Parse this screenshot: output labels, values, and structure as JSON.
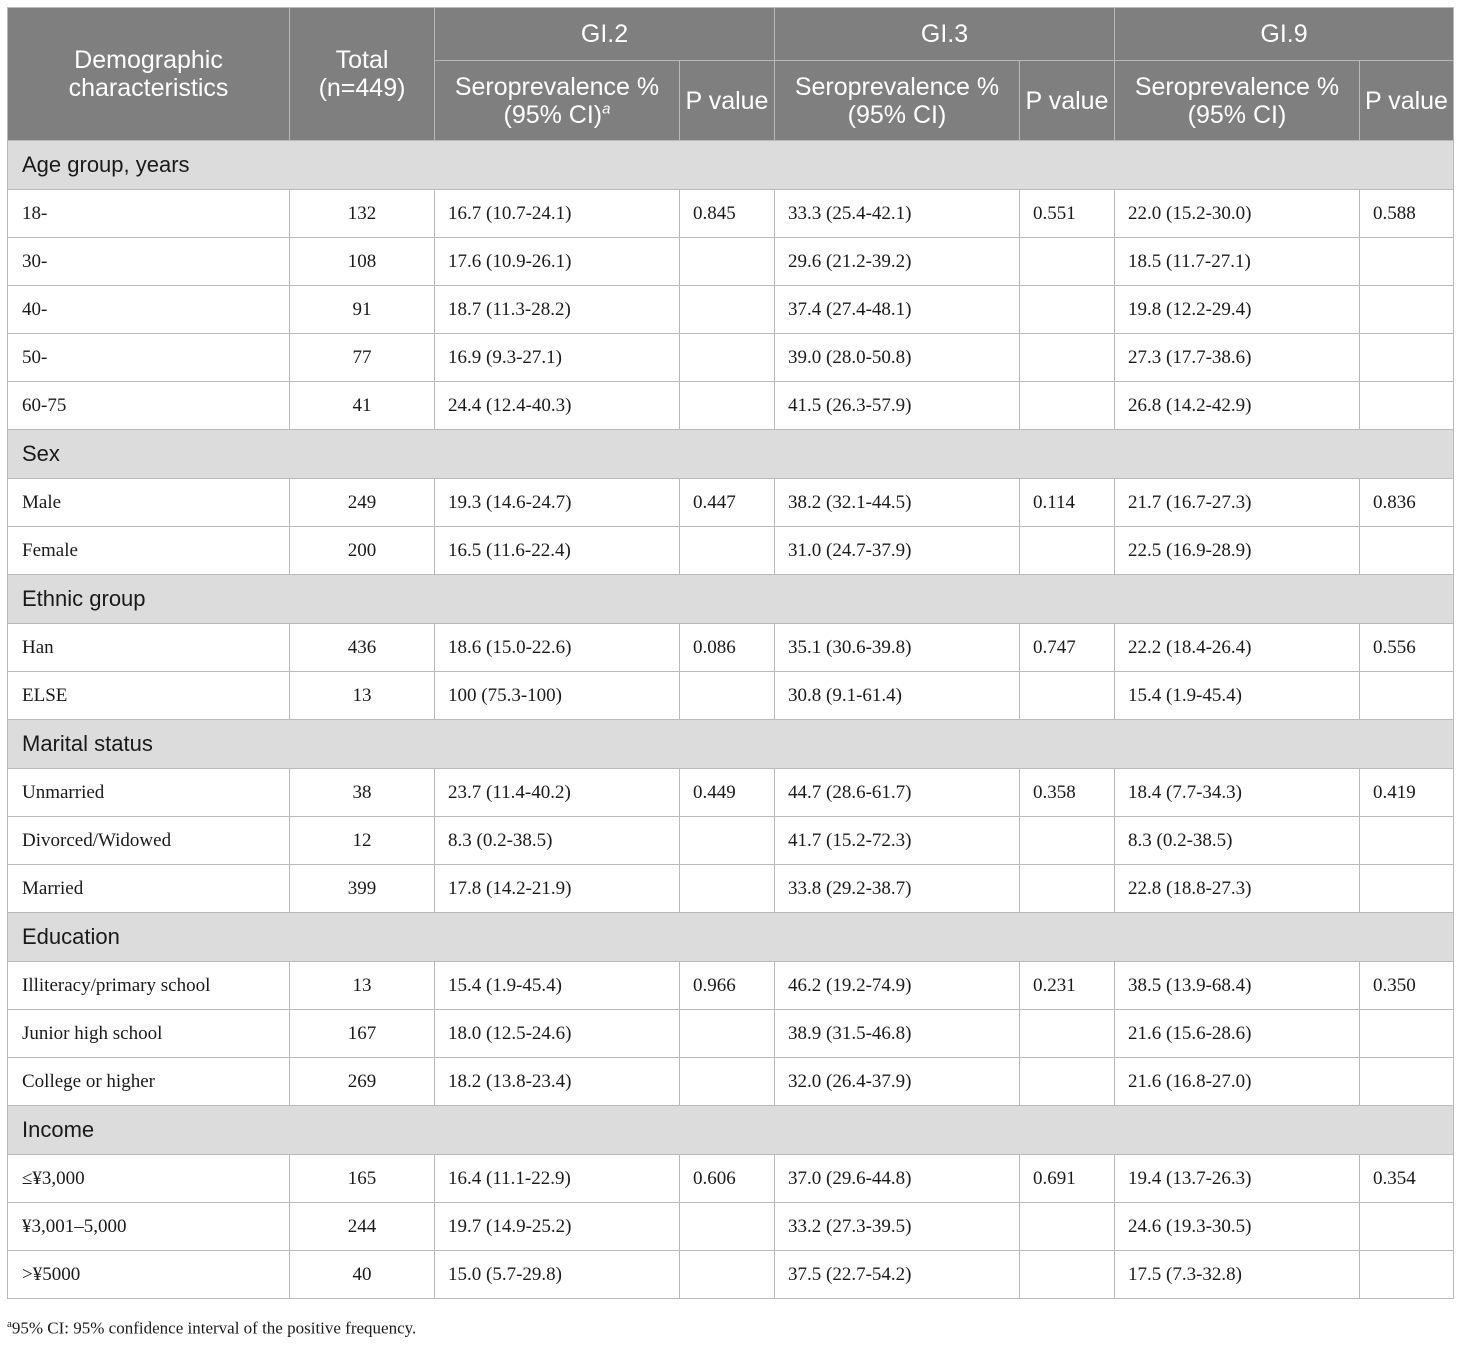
{
  "header": {
    "demographic": "Demographic characteristics",
    "total": "Total (n=449)",
    "groups": [
      "GI.2",
      "GI.3",
      "GI.9"
    ],
    "seroprevalence_gi2": "Seroprevalence % (95% CI)",
    "footnote_marker": "a",
    "seroprevalence": "Seroprevalence % (95% CI)",
    "p_value": "P value"
  },
  "sections": [
    {
      "title": "Age group, years",
      "rows": [
        {
          "label": "18-",
          "total": "132",
          "gi2": "16.7 (10.7-24.1)",
          "gi2_p": "0.845",
          "gi3": "33.3 (25.4-42.1)",
          "gi3_p": "0.551",
          "gi9": "22.0 (15.2-30.0)",
          "gi9_p": "0.588"
        },
        {
          "label": "30-",
          "total": "108",
          "gi2": "17.6 (10.9-26.1)",
          "gi2_p": "",
          "gi3": "29.6 (21.2-39.2)",
          "gi3_p": "",
          "gi9": "18.5 (11.7-27.1)",
          "gi9_p": ""
        },
        {
          "label": "40-",
          "total": "91",
          "gi2": "18.7 (11.3-28.2)",
          "gi2_p": "",
          "gi3": "37.4 (27.4-48.1)",
          "gi3_p": "",
          "gi9": "19.8 (12.2-29.4)",
          "gi9_p": ""
        },
        {
          "label": "50-",
          "total": "77",
          "gi2": "16.9 (9.3-27.1)",
          "gi2_p": "",
          "gi3": "39.0 (28.0-50.8)",
          "gi3_p": "",
          "gi9": "27.3 (17.7-38.6)",
          "gi9_p": ""
        },
        {
          "label": "60-75",
          "total": "41",
          "gi2": "24.4 (12.4-40.3)",
          "gi2_p": "",
          "gi3": "41.5 (26.3-57.9)",
          "gi3_p": "",
          "gi9": "26.8 (14.2-42.9)",
          "gi9_p": ""
        }
      ]
    },
    {
      "title": "Sex",
      "rows": [
        {
          "label": "Male",
          "total": "249",
          "gi2": "19.3 (14.6-24.7)",
          "gi2_p": "0.447",
          "gi3": "38.2 (32.1-44.5)",
          "gi3_p": "0.114",
          "gi9": "21.7 (16.7-27.3)",
          "gi9_p": "0.836"
        },
        {
          "label": "Female",
          "total": "200",
          "gi2": "16.5 (11.6-22.4)",
          "gi2_p": "",
          "gi3": "31.0 (24.7-37.9)",
          "gi3_p": "",
          "gi9": "22.5 (16.9-28.9)",
          "gi9_p": ""
        }
      ]
    },
    {
      "title": "Ethnic group",
      "rows": [
        {
          "label": "Han",
          "total": "436",
          "gi2": "18.6 (15.0-22.6)",
          "gi2_p": "0.086",
          "gi3": "35.1 (30.6-39.8)",
          "gi3_p": "0.747",
          "gi9": "22.2 (18.4-26.4)",
          "gi9_p": "0.556"
        },
        {
          "label": "ELSE",
          "total": "13",
          "gi2": "100 (75.3-100)",
          "gi2_p": "",
          "gi3": "30.8 (9.1-61.4)",
          "gi3_p": "",
          "gi9": "15.4 (1.9-45.4)",
          "gi9_p": ""
        }
      ]
    },
    {
      "title": "Marital status",
      "rows": [
        {
          "label": "Unmarried",
          "total": "38",
          "gi2": "23.7 (11.4-40.2)",
          "gi2_p": "0.449",
          "gi3": "44.7 (28.6-61.7)",
          "gi3_p": "0.358",
          "gi9": "18.4 (7.7-34.3)",
          "gi9_p": "0.419"
        },
        {
          "label": "Divorced/Widowed",
          "total": "12",
          "gi2": "8.3 (0.2-38.5)",
          "gi2_p": "",
          "gi3": "41.7 (15.2-72.3)",
          "gi3_p": "",
          "gi9": "8.3 (0.2-38.5)",
          "gi9_p": ""
        },
        {
          "label": "Married",
          "total": "399",
          "gi2": "17.8 (14.2-21.9)",
          "gi2_p": "",
          "gi3": "33.8 (29.2-38.7)",
          "gi3_p": "",
          "gi9": "22.8 (18.8-27.3)",
          "gi9_p": ""
        }
      ]
    },
    {
      "title": "Education",
      "rows": [
        {
          "label": "Illiteracy/primary school",
          "total": "13",
          "gi2": "15.4 (1.9-45.4)",
          "gi2_p": "0.966",
          "gi3": "46.2 (19.2-74.9)",
          "gi3_p": "0.231",
          "gi9": "38.5 (13.9-68.4)",
          "gi9_p": "0.350"
        },
        {
          "label": "Junior high school",
          "total": "167",
          "gi2": "18.0 (12.5-24.6)",
          "gi2_p": "",
          "gi3": "38.9 (31.5-46.8)",
          "gi3_p": "",
          "gi9": "21.6 (15.6-28.6)",
          "gi9_p": ""
        },
        {
          "label": "College or higher",
          "total": "269",
          "gi2": "18.2 (13.8-23.4)",
          "gi2_p": "",
          "gi3": "32.0 (26.4-37.9)",
          "gi3_p": "",
          "gi9": "21.6 (16.8-27.0)",
          "gi9_p": ""
        }
      ]
    },
    {
      "title": "Income",
      "rows": [
        {
          "label": "≤¥3,000",
          "total": "165",
          "gi2": "16.4 (11.1-22.9)",
          "gi2_p": "0.606",
          "gi3": "37.0 (29.6-44.8)",
          "gi3_p": "0.691",
          "gi9": "19.4 (13.7-26.3)",
          "gi9_p": "0.354"
        },
        {
          "label": "¥3,001–5,000",
          "total": "244",
          "gi2": "19.7 (14.9-25.2)",
          "gi2_p": "",
          "gi3": "33.2 (27.3-39.5)",
          "gi3_p": "",
          "gi9": "24.6 (19.3-30.5)",
          "gi9_p": ""
        },
        {
          "label": ">¥5000",
          "total": "40",
          "gi2": "15.0 (5.7-29.8)",
          "gi2_p": "",
          "gi3": "37.5 (22.7-54.2)",
          "gi3_p": "",
          "gi9": "17.5 (7.3-32.8)",
          "gi9_p": ""
        }
      ]
    }
  ],
  "footnote": {
    "marker": "a",
    "text": "95% CI: 95% confidence interval of the positive frequency."
  }
}
